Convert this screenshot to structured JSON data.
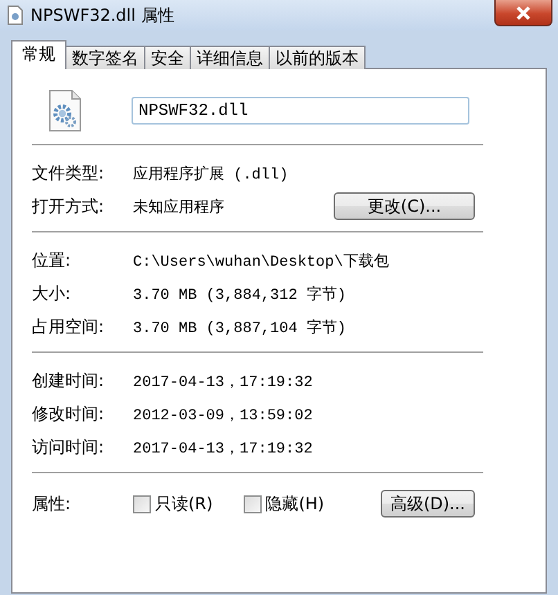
{
  "window": {
    "title": "NPSWF32.dll 属性"
  },
  "tabs": [
    {
      "label": "常规",
      "selected": true
    },
    {
      "label": "数字签名",
      "selected": false
    },
    {
      "label": "安全",
      "selected": false
    },
    {
      "label": "详细信息",
      "selected": false
    },
    {
      "label": "以前的版本",
      "selected": false
    }
  ],
  "file_name": {
    "value": "NPSWF32.dll"
  },
  "sections": [
    [
      {
        "kind": "text",
        "label": "文件类型:",
        "value": "应用程序扩展 (.dll)"
      },
      {
        "kind": "button",
        "label": "打开方式:",
        "value": "未知应用程序",
        "button": "更改(C)..."
      }
    ],
    [
      {
        "kind": "text",
        "label": "位置:",
        "value": "C:\\Users\\wuhan\\Desktop\\下载包"
      },
      {
        "kind": "text",
        "label": "大小:",
        "value": "3.70 MB (3,884,312 字节)"
      },
      {
        "kind": "text",
        "label": "占用空间:",
        "value": "3.70 MB (3,887,104 字节)"
      }
    ],
    [
      {
        "kind": "text",
        "label": "创建时间:",
        "value": "2017-04-13，17:19:32"
      },
      {
        "kind": "text",
        "label": "修改时间:",
        "value": "2012-03-09，13:59:02"
      },
      {
        "kind": "text",
        "label": "访问时间:",
        "value": "2017-04-13，17:19:32"
      }
    ],
    [
      {
        "kind": "attributes",
        "label": "属性:",
        "checkboxes": [
          {
            "label": "只读(R)",
            "checked": false
          },
          {
            "label": "隐藏(H)",
            "checked": false
          }
        ],
        "button": "高级(D)..."
      }
    ]
  ]
}
